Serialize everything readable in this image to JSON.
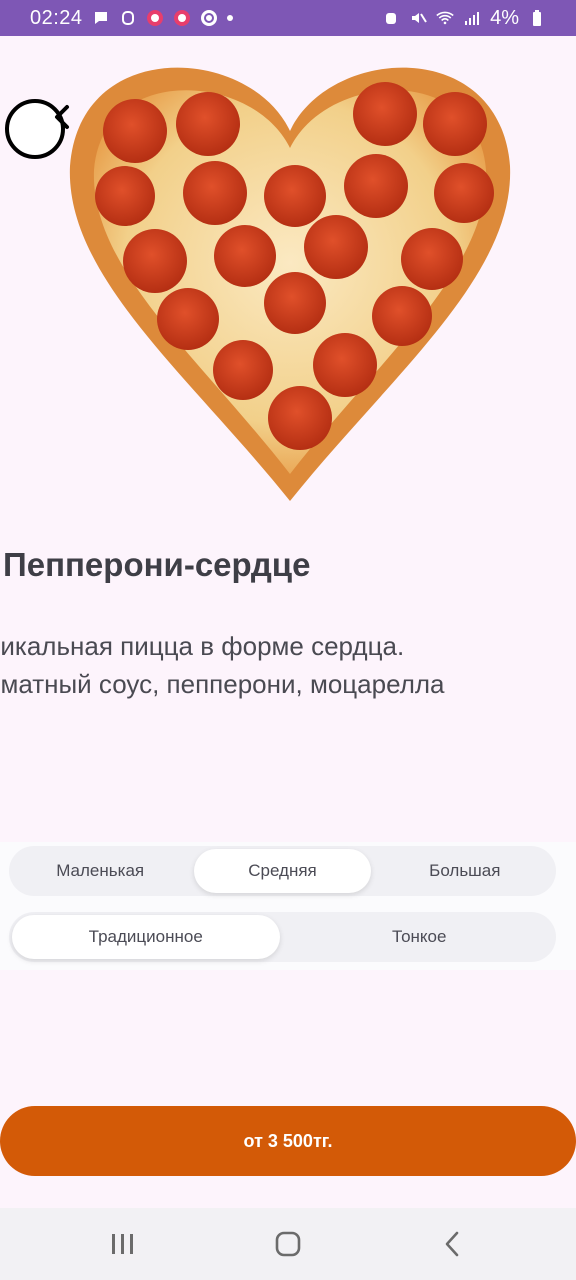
{
  "status_bar": {
    "time": "02:24",
    "battery": "4%",
    "left_icons": [
      "message-icon",
      "mask-icon",
      "app-icon",
      "app-icon",
      "refresh-icon",
      "dot-icon"
    ],
    "right_icons": [
      "alarm-icon",
      "mute-icon",
      "wifi-icon",
      "signal-icon",
      "battery-icon"
    ]
  },
  "product": {
    "name": "Пепперони-сердце",
    "description_line1": "никальная пицца в форме сердца.",
    "description_line2": "оматный соус, пепперони, моцарелла"
  },
  "size_options": {
    "items": [
      "Маленькая",
      "Средняя",
      "Большая"
    ],
    "selected": "Средняя"
  },
  "crust_options": {
    "items": [
      "Традиционное",
      "Тонкое"
    ],
    "selected": "Традиционное"
  },
  "order": {
    "label": "от 3 500тг."
  },
  "colors": {
    "status_bar": "#7e57b5",
    "background": "#fdf4fc",
    "accent": "#d35a07"
  }
}
